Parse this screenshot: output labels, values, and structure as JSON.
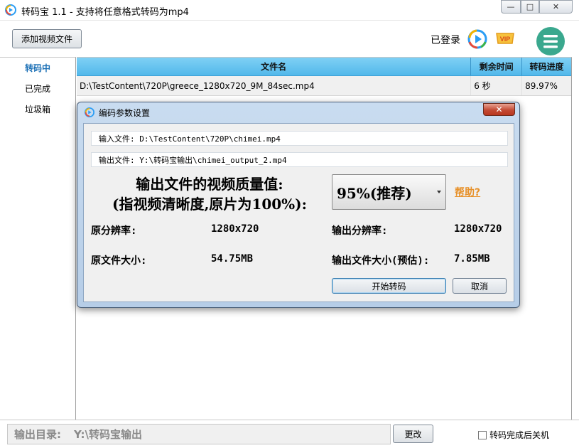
{
  "window": {
    "title": "转码宝 1.1 - 支持将任意格式转码为mp4",
    "minimize": "—",
    "maximize": "□",
    "close": "✕"
  },
  "toolbar": {
    "add_video": "添加视频文件",
    "login_status": "已登录",
    "vip_badge": "VIP"
  },
  "sidebar": {
    "items": [
      {
        "label": "转码中"
      },
      {
        "label": "已完成"
      },
      {
        "label": "垃圾箱"
      }
    ]
  },
  "table": {
    "columns": [
      "文件名",
      "剩余时间",
      "转码进度"
    ],
    "rows": [
      {
        "file": "D:\\TestContent\\720P\\greece_1280x720_9M_84sec.mp4",
        "remaining": "6 秒",
        "progress": "89.97%"
      }
    ]
  },
  "bottom": {
    "output_label": "输出目录:",
    "output_path": "Y:\\转码宝输出",
    "change_button": "更改",
    "shutdown_label": "转码完成后关机"
  },
  "dialog": {
    "title": "编码参数设置",
    "close": "✕",
    "input_file": "输入文件: D:\\TestContent\\720P\\chimei.mp4",
    "output_file": "输出文件: Y:\\转码宝输出\\chimei_output_2.mp4",
    "quality_label_line1": "输出文件的视频质量值:",
    "quality_label_line2": "(指视频清晰度,原片为100%):",
    "quality_value": "95%(推荐)",
    "help_link": "帮助?",
    "orig_res_label": "原分辨率:",
    "orig_res_value": "1280x720",
    "out_res_label": "输出分辨率:",
    "out_res_value": "1280x720",
    "orig_size_label": "原文件大小:",
    "orig_size_value": "54.75MB",
    "out_size_label": "输出文件大小(预估):",
    "out_size_value": "7.85MB",
    "start_button": "开始转码",
    "cancel_button": "取消"
  },
  "colors": {
    "header_blue": "#52b8ea",
    "active_tab": "#1a6fb5",
    "help_orange": "#e7912a",
    "menu_green": "#3aa88e"
  }
}
